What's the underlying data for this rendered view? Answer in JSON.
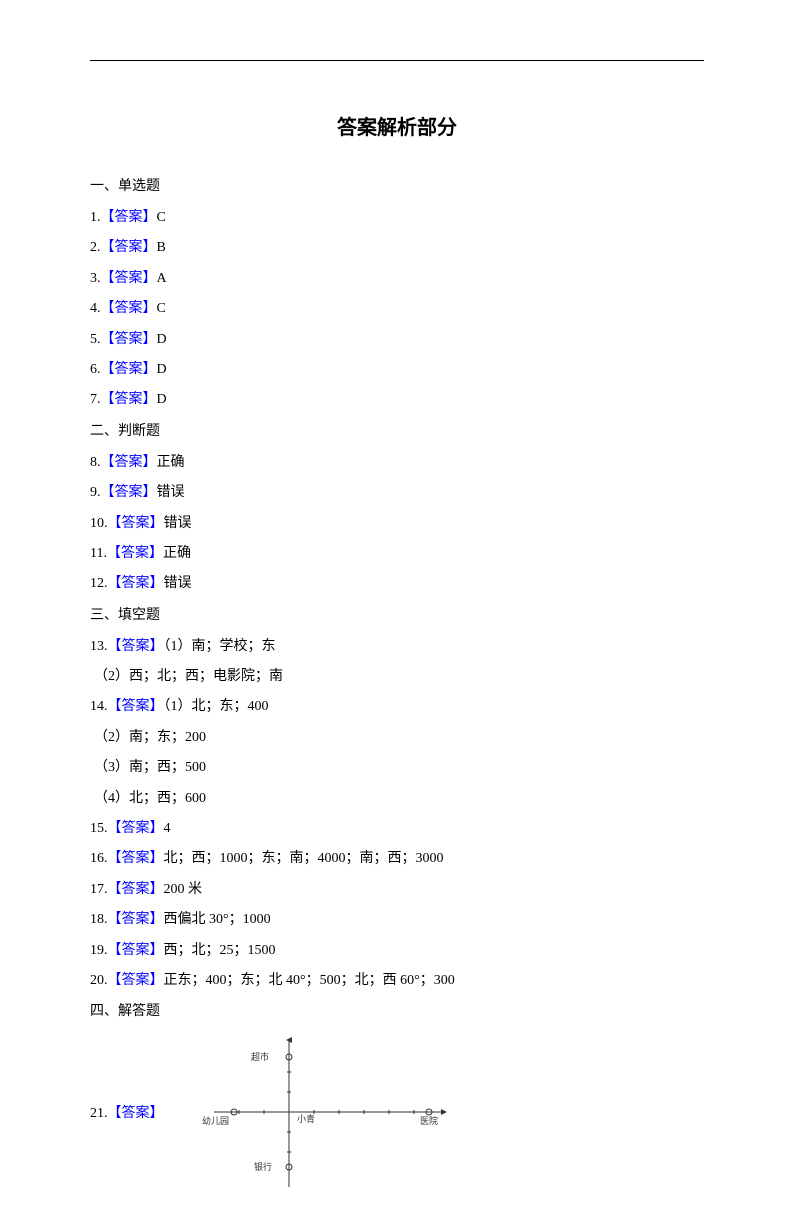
{
  "title": "答案解析部分",
  "sections": {
    "s1": "一、单选题",
    "s2": "二、判断题",
    "s3": "三、填空题",
    "s4": "四、解答题"
  },
  "labels": {
    "answer": "【答案】"
  },
  "mc": {
    "q1": {
      "num": "1.",
      "ans": "C"
    },
    "q2": {
      "num": "2.",
      "ans": "B"
    },
    "q3": {
      "num": "3.",
      "ans": "A"
    },
    "q4": {
      "num": "4.",
      "ans": "C"
    },
    "q5": {
      "num": "5.",
      "ans": "D"
    },
    "q6": {
      "num": "6.",
      "ans": "D"
    },
    "q7": {
      "num": "7.",
      "ans": "D"
    }
  },
  "tf": {
    "q8": {
      "num": "8.",
      "ans": "正确"
    },
    "q9": {
      "num": "9.",
      "ans": "错误"
    },
    "q10": {
      "num": "10.",
      "ans": "错误"
    },
    "q11": {
      "num": "11.",
      "ans": "正确"
    },
    "q12": {
      "num": "12.",
      "ans": "错误"
    }
  },
  "fill": {
    "q13": {
      "num": "13.",
      "p1": "（1）南；学校；东",
      "p2": "（2）西；北；西；电影院；南"
    },
    "q14": {
      "num": "14.",
      "p1": "（1）北；东；400",
      "p2": "（2）南；东；200",
      "p3": "（3）南；西；500",
      "p4": "（4）北；西；600"
    },
    "q15": {
      "num": "15.",
      "ans": "4"
    },
    "q16": {
      "num": "16.",
      "ans": "北；西；1000；东；南；4000；南；西；3000"
    },
    "q17": {
      "num": "17.",
      "ans": "200 米"
    },
    "q18": {
      "num": "18.",
      "ans": "西偏北 30°；1000"
    },
    "q19": {
      "num": "19.",
      "ans": "西；北；25；1500"
    },
    "q20": {
      "num": "20.",
      "ans": "正东；400；东；北 40°；500；北；西 60°；300"
    }
  },
  "solve": {
    "q21": {
      "num": "21."
    }
  },
  "chart_data": {
    "type": "scatter",
    "origin_label": "小青",
    "points": [
      {
        "label": "超市",
        "x": 0,
        "y": 3
      },
      {
        "label": "幼儿园",
        "x": -3,
        "y": 0
      },
      {
        "label": "医院",
        "x": 6,
        "y": 0
      },
      {
        "label": "银行",
        "x": 0,
        "y": -3
      }
    ],
    "xrange": [
      -4,
      7
    ],
    "yrange": [
      -4,
      4
    ],
    "grid": false
  }
}
